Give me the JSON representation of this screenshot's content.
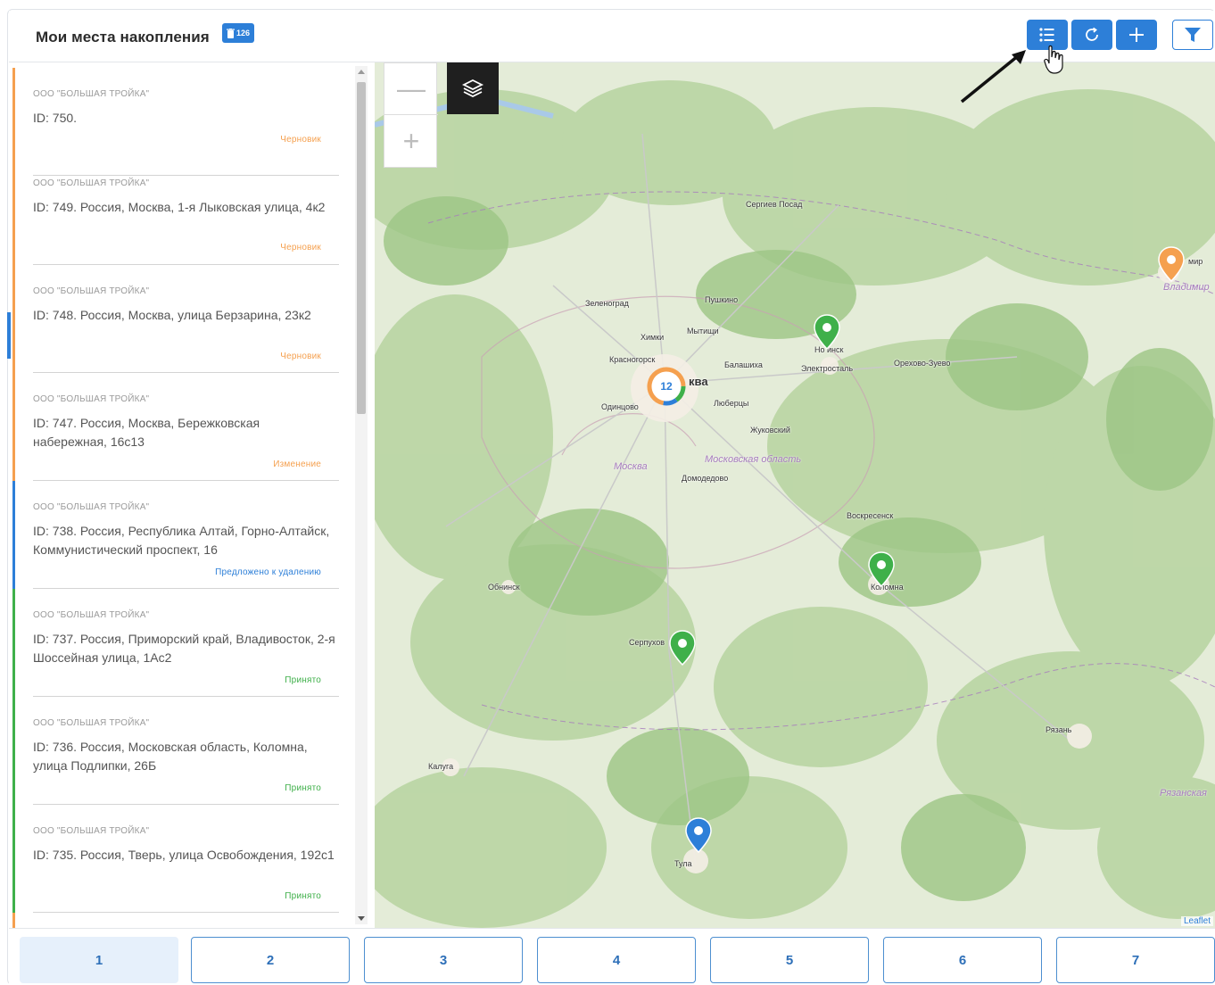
{
  "header": {
    "title": "Мои места накопления",
    "count_badge": "126"
  },
  "toolbar": {
    "list_icon": "list-icon",
    "refresh_icon": "refresh-icon",
    "add_icon": "plus-icon",
    "filter_icon": "filter-icon"
  },
  "list": {
    "items": [
      {
        "company": "ООО \"БОЛЬШАЯ ТРОЙКА\"",
        "address": "ID: 750.",
        "status": "Черновик",
        "status_color": "#f5a04f"
      },
      {
        "company": "ООО \"БОЛЬШАЯ ТРОЙКА\"",
        "address": "ID: 749. Россия, Москва, 1-я Лыковская улица, 4к2",
        "status": "Черновик",
        "status_color": "#f5a04f"
      },
      {
        "company": "ООО \"БОЛЬШАЯ ТРОЙКА\"",
        "address": "ID: 748. Россия, Москва, улица Берзарина, 23к2",
        "status": "Черновик",
        "status_color": "#f5a04f"
      },
      {
        "company": "ООО \"БОЛЬШАЯ ТРОЙКА\"",
        "address": "ID: 747. Россия, Москва, Бережковская набережная, 16с13",
        "status": "Изменение",
        "status_color": "#f5a04f"
      },
      {
        "company": "ООО \"БОЛЬШАЯ ТРОЙКА\"",
        "address": "ID: 738. Россия, Республика Алтай, Горно-Алтайск, Коммунистический проспект, 16",
        "status": "Предложено к удалению",
        "status_color": "#2d7fd8"
      },
      {
        "company": "ООО \"БОЛЬШАЯ ТРОЙКА\"",
        "address": "ID: 737. Россия, Приморский край, Владивосток, 2-я Шоссейная улица, 1Ас2",
        "status": "Принято",
        "status_color": "#3fb04a"
      },
      {
        "company": "ООО \"БОЛЬШАЯ ТРОЙКА\"",
        "address": "ID: 736. Россия, Московская область, Коломна, улица Подлипки, 26Б",
        "status": "Принято",
        "status_color": "#3fb04a"
      },
      {
        "company": "ООО \"БОЛЬШАЯ ТРОЙКА\"",
        "address": "ID: 735. Россия, Тверь, улица Освобождения, 192с1",
        "status": "Принято",
        "status_color": "#3fb04a"
      }
    ]
  },
  "map": {
    "zoom_out": "—",
    "zoom_in": "+",
    "cluster_count": "12",
    "attribution": "Leaflet",
    "cities": [
      "Сергиев Посад",
      "Зеленоград",
      "Пушкино",
      "Химки",
      "Мытищи",
      "Красногорск",
      "Балашиха",
      "Электросталь",
      "Орехово-Зуево",
      "Одинцово",
      "ква",
      "Люберцы",
      "Жуковский",
      "Домодедово",
      "Воскресенск",
      "Обнинск",
      "Коломна",
      "Серпухов",
      "Калуга",
      "Рязань",
      "Тула",
      "Но инск",
      "мир"
    ],
    "regions": [
      "Москва",
      "Московская область",
      "Владимир",
      "Рязанская"
    ]
  },
  "pagination": {
    "pages": [
      "1",
      "2",
      "3",
      "4",
      "5",
      "6",
      "7"
    ],
    "active": "1"
  },
  "colors": {
    "accent": "#2d7fd8",
    "draft": "#f5a04f",
    "accepted": "#3fb04a"
  }
}
